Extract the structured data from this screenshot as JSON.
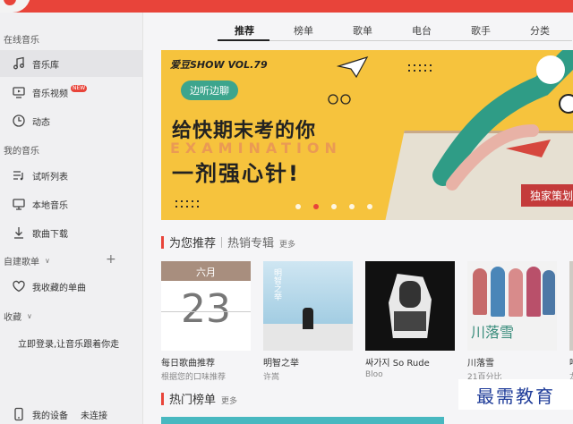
{
  "sidebar": {
    "online_header": "在线音乐",
    "items_online": [
      {
        "label": "音乐库",
        "icon": "music-note-icon"
      },
      {
        "label": "音乐视频",
        "icon": "video-icon",
        "badge": "NEW"
      },
      {
        "label": "动态",
        "icon": "activity-icon"
      }
    ],
    "my_header": "我的音乐",
    "items_my": [
      {
        "label": "试听列表",
        "icon": "playlist-icon"
      },
      {
        "label": "本地音乐",
        "icon": "monitor-icon"
      },
      {
        "label": "歌曲下载",
        "icon": "download-icon"
      }
    ],
    "created_header": "自建歌单",
    "favorite_label": "我收藏的单曲",
    "collect_header": "收藏",
    "login_prompt": "立即登录,让音乐跟着你走",
    "device_label": "我的设备",
    "device_status": "未连接"
  },
  "tabs": [
    "推荐",
    "榜单",
    "歌单",
    "电台",
    "歌手",
    "分类"
  ],
  "banner": {
    "show_title": "爱豆SHOW VOL.79",
    "pill": "边听边聊",
    "line1": "给快期末考的你",
    "overlay_text": "EXAMINATION",
    "line2": "一剂强心针!",
    "tag": "独家策划"
  },
  "recommend": {
    "title": "为您推荐",
    "alt_tab": "热销专辑",
    "more": "更多",
    "cards": [
      {
        "title": "每日歌曲推荐",
        "sub": "根据您的口味推荐",
        "month": "六月",
        "day": "23"
      },
      {
        "title": "明智之举",
        "sub": "许嵩",
        "cover_text": "明智之举"
      },
      {
        "title": "싸가지 So Rude",
        "sub": "Bloo"
      },
      {
        "title": "川落雪",
        "sub": "21百分比",
        "cover_text": "川落雪"
      },
      {
        "title": "哈",
        "sub": "龙"
      }
    ]
  },
  "hot": {
    "title": "热门榜单",
    "more": "更多"
  },
  "watermark": "最需教育",
  "colors": {
    "accent": "#e8443a",
    "banner_bg": "#f6c33d",
    "pill": "#3da58d"
  }
}
